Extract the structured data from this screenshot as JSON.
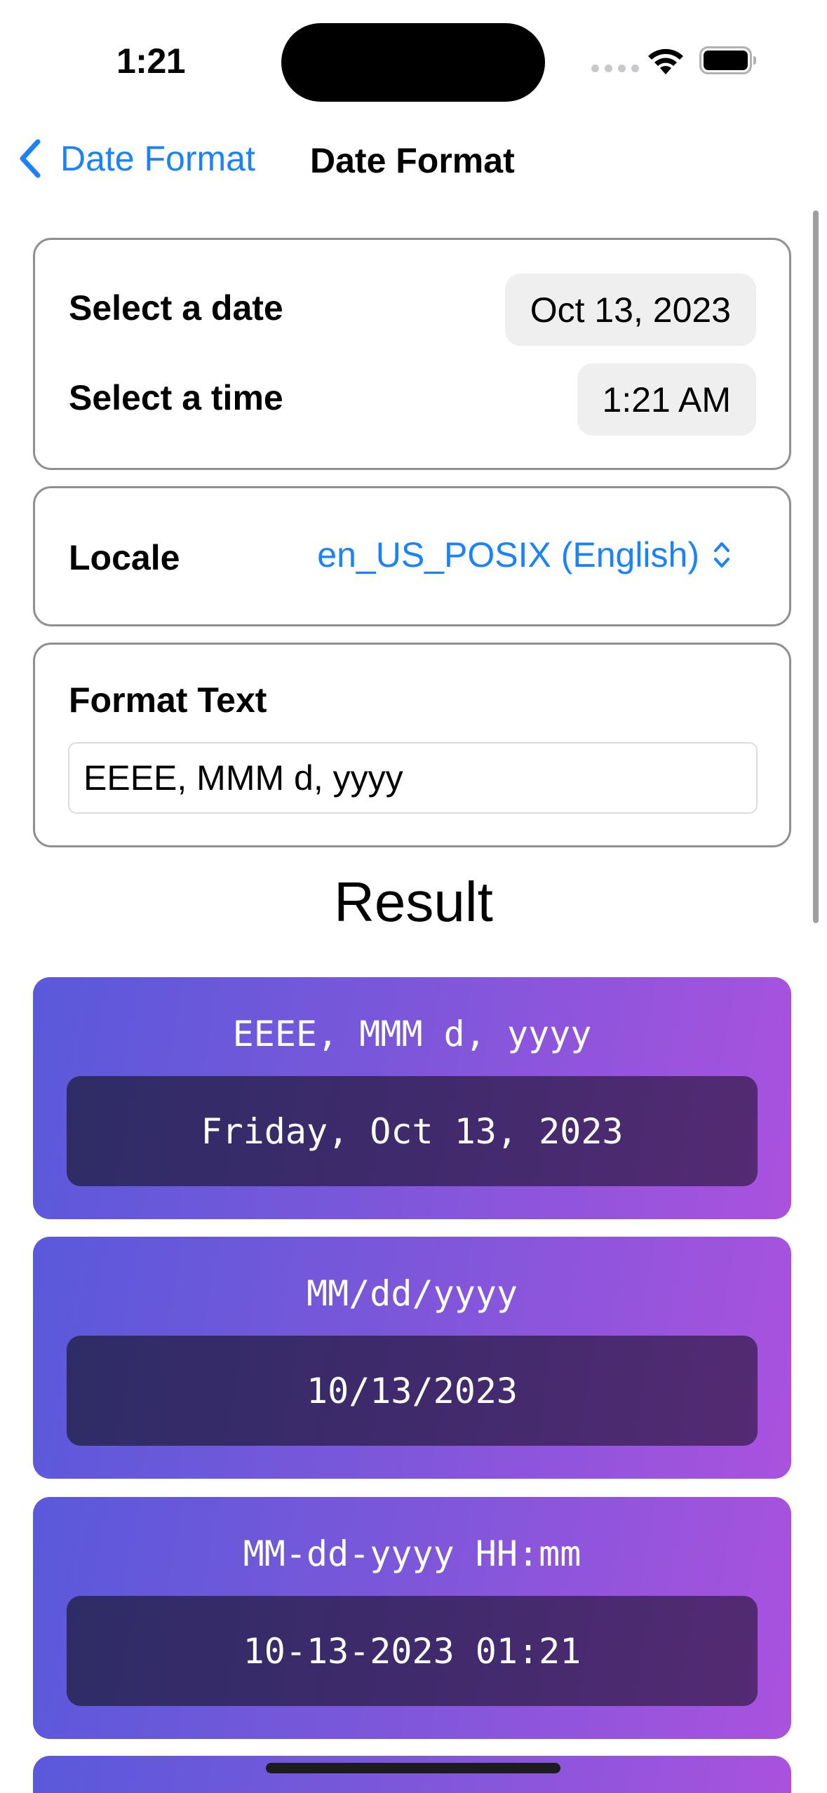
{
  "status_bar": {
    "time": "1:21"
  },
  "nav": {
    "back_label": "Date Format",
    "title": "Date Format"
  },
  "date_time_card": {
    "date_label": "Select a date",
    "date_value": "Oct 13, 2023",
    "time_label": "Select a time",
    "time_value": "1:21 AM"
  },
  "locale_card": {
    "label": "Locale",
    "value": "en_US_POSIX (English)"
  },
  "format_card": {
    "label": "Format Text",
    "input_value": "EEEE, MMM d, yyyy"
  },
  "result": {
    "heading": "Result",
    "items": [
      {
        "pattern": "EEEE, MMM d, yyyy",
        "output": "Friday, Oct 13, 2023"
      },
      {
        "pattern": "MM/dd/yyyy",
        "output": "10/13/2023"
      },
      {
        "pattern": "MM-dd-yyyy HH:mm",
        "output": "10-13-2023 01:21"
      }
    ]
  },
  "colors": {
    "accent": "#1a82ff",
    "card_border": "#8e8e93",
    "result_gradient_start": "#5a59db",
    "result_gradient_end": "#aa52de",
    "result_box_start": "#2e2c66",
    "result_box_end": "#542a73"
  },
  "icons": {
    "back": "chevron-left-icon",
    "locale_picker": "chevron-up-down-icon",
    "wifi": "wifi-icon",
    "battery": "battery-icon",
    "signal": "cellular-signal-icon"
  }
}
